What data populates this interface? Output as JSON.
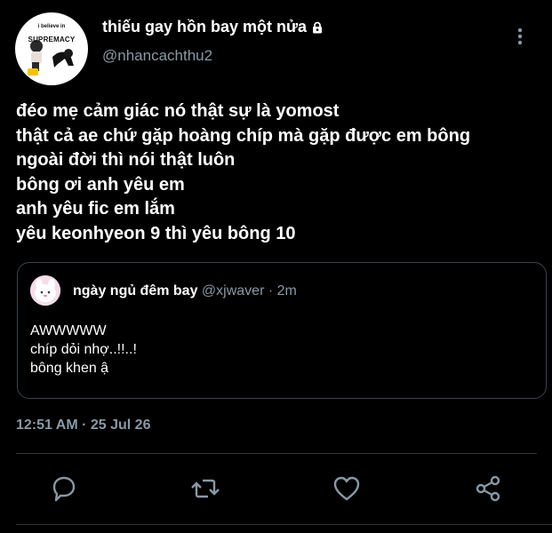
{
  "author": {
    "display_name": "thiếu gay hồn bay một nửa",
    "handle": "@nhancachthu2",
    "avatar_text_top": "i believe in",
    "avatar_text_main": "SUPREMACY",
    "protected_icon": "lock-icon"
  },
  "tweet": {
    "lines": [
      "đéo mẹ cảm giác nó thật sự là yomost",
      "thật cả ae chứ gặp hoàng chíp mà gặp được em bông",
      "ngoài đời thì nói thật luôn",
      "bông ơi anh yêu em",
      "anh yêu fic em lắm",
      "yêu keonhyeon 9 thì yêu bông 10"
    ],
    "timestamp": "12:51 AM · 25 Jul 26"
  },
  "quoted": {
    "display_name": "ngày ngủ đêm bay",
    "meta": "@xjwaver · 2m",
    "lines": [
      "AWWWWW",
      "chíp dỏi nhợ..!!..!",
      "bông khen ậ"
    ]
  },
  "actions": [
    "reply-icon",
    "retweet-icon",
    "like-icon",
    "share-icon"
  ],
  "colors": {
    "background": "#000000",
    "secondary_text": "#8899a6",
    "border": "#38444d",
    "icon": "#8899a6"
  }
}
